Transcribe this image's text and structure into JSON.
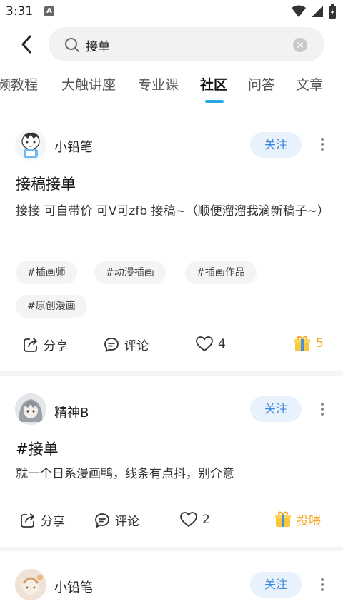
{
  "status_bar": {
    "time": "3:31",
    "app_indicator": "A"
  },
  "search": {
    "query": "接单"
  },
  "tabs": [
    {
      "label": "频教程"
    },
    {
      "label": "大触讲座"
    },
    {
      "label": "专业课"
    },
    {
      "label": "社区",
      "active": true
    },
    {
      "label": "问答"
    },
    {
      "label": "文章"
    }
  ],
  "posts": [
    {
      "username": "小铅笔",
      "follow_label": "关注",
      "title": "接稿接单",
      "body": "接接 可自带价 可V可zfb 接稿~（顺便溜溜我滴新稿子~）",
      "tags": [
        "#插画师",
        "#动漫插画",
        "#插画作品",
        "#原创漫画"
      ],
      "share_label": "分享",
      "comment_label": "评论",
      "likes": "4",
      "gift_label": "5"
    },
    {
      "username": "精神B",
      "follow_label": "关注",
      "title": "#接单",
      "body": "就一个日系漫画鸭，线条有点抖，别介意",
      "share_label": "分享",
      "comment_label": "评论",
      "likes": "2",
      "gift_label": "投喂"
    },
    {
      "username": "小铅笔",
      "follow_label": "关注"
    }
  ],
  "colors": {
    "accent": "#2aa8e4",
    "follow_bg": "#e9f1fc",
    "follow_text": "#3b8ad9",
    "gift": "#f5a623"
  }
}
